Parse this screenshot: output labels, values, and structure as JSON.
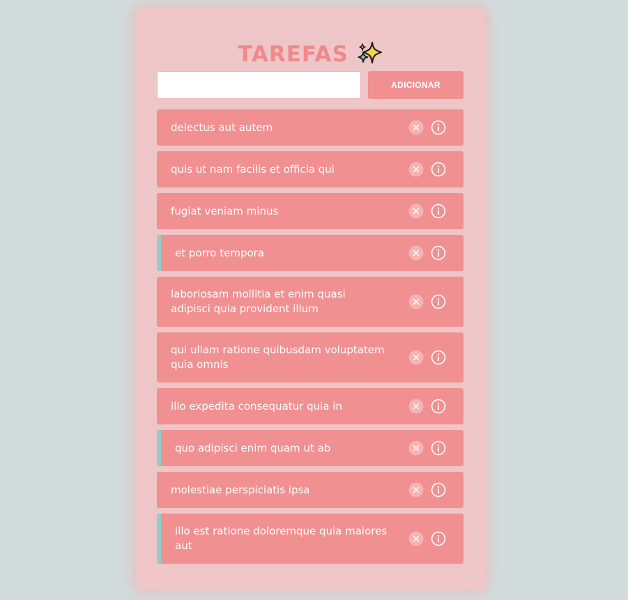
{
  "header": {
    "title": "TAREFAS",
    "emoji_icon": "sparkles-icon"
  },
  "form": {
    "input_value": "",
    "input_placeholder": "",
    "add_label": "ADICIONAR"
  },
  "colors": {
    "background": "#d3dcdc",
    "card": "#efc6c7",
    "accent": "#f19091",
    "title": "#f0898c",
    "completed_marker": "#8fcfc8"
  },
  "tasks": [
    {
      "text": "delectus aut autem",
      "completed": false
    },
    {
      "text": "quis ut nam facilis et officia qui",
      "completed": false
    },
    {
      "text": "fugiat veniam minus",
      "completed": false
    },
    {
      "text": "et porro tempora",
      "completed": true
    },
    {
      "text": "laboriosam mollitia et enim quasi adipisci quia provident illum",
      "completed": false
    },
    {
      "text": "qui ullam ratione quibusdam voluptatem quia omnis",
      "completed": false
    },
    {
      "text": "illo expedita consequatur quia in",
      "completed": false
    },
    {
      "text": "quo adipisci enim quam ut ab",
      "completed": true
    },
    {
      "text": "molestiae perspiciatis ipsa",
      "completed": false
    },
    {
      "text": "illo est ratione doloremque quia maiores aut",
      "completed": true
    }
  ]
}
